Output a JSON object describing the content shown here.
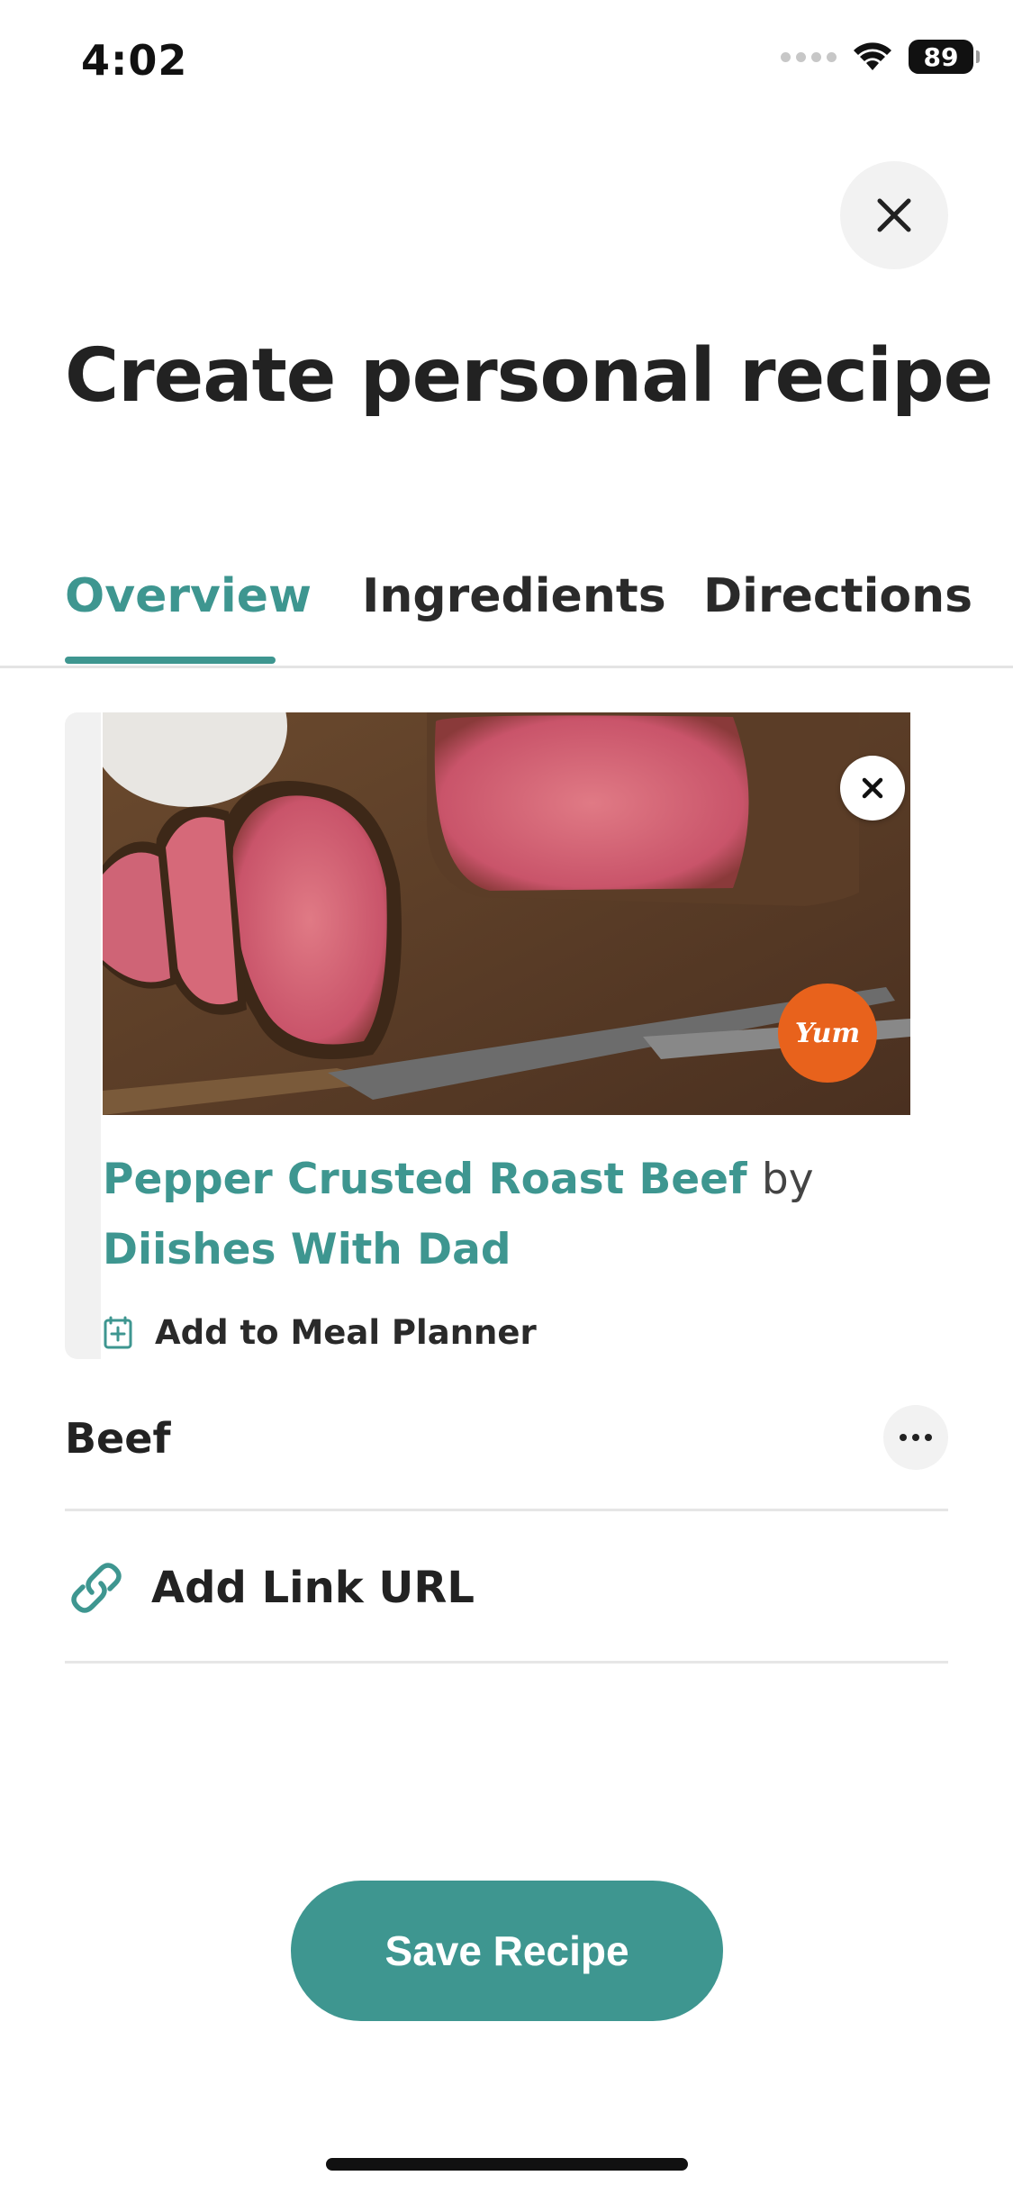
{
  "status_bar": {
    "time": "4:02",
    "battery": "89"
  },
  "header": {
    "title": "Create personal recipe"
  },
  "tabs": [
    {
      "label": "Overview",
      "active": true
    },
    {
      "label": "Ingredients",
      "active": false
    },
    {
      "label": "Directions",
      "active": false
    }
  ],
  "recipe_card": {
    "title": "Pepper Crusted Roast Beef",
    "by": "by",
    "author": "Diishes With Dad",
    "badge": "Yum",
    "meal_planner_label": "Add to Meal Planner"
  },
  "category": {
    "label": "Beef"
  },
  "link": {
    "label": "Add Link URL"
  },
  "save_button": {
    "label": "Save Recipe"
  },
  "colors": {
    "accent": "#3e9690",
    "badge": "#e8621c"
  },
  "icons": [
    "close-icon",
    "wifi-icon",
    "battery-icon",
    "photo-remove-icon",
    "calendar-add-icon",
    "more-icon",
    "link-icon"
  ]
}
